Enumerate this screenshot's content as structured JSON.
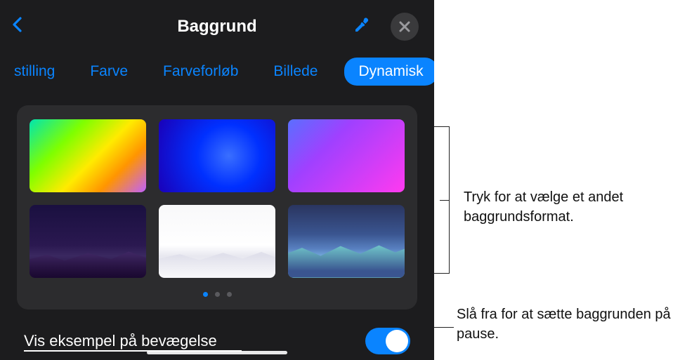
{
  "header": {
    "title": "Baggrund"
  },
  "tabs": {
    "items": [
      {
        "label": "stilling",
        "active": false
      },
      {
        "label": "Farve",
        "active": false
      },
      {
        "label": "Farveforløb",
        "active": false
      },
      {
        "label": "Billede",
        "active": false
      },
      {
        "label": "Dynamisk",
        "active": true
      }
    ]
  },
  "swatches": {
    "names": [
      "gradient-rainbow",
      "gradient-blue",
      "gradient-purple-pink",
      "landscape-dark",
      "landscape-light",
      "landscape-teal"
    ],
    "page_count": 3,
    "active_page": 0
  },
  "preview": {
    "label": "Vis eksempel på bevægelse",
    "enabled": true
  },
  "callouts": {
    "format": "Tryk for at vælge et andet baggrundsformat.",
    "pause": "Slå fra for at sætte baggrunden på pause."
  }
}
